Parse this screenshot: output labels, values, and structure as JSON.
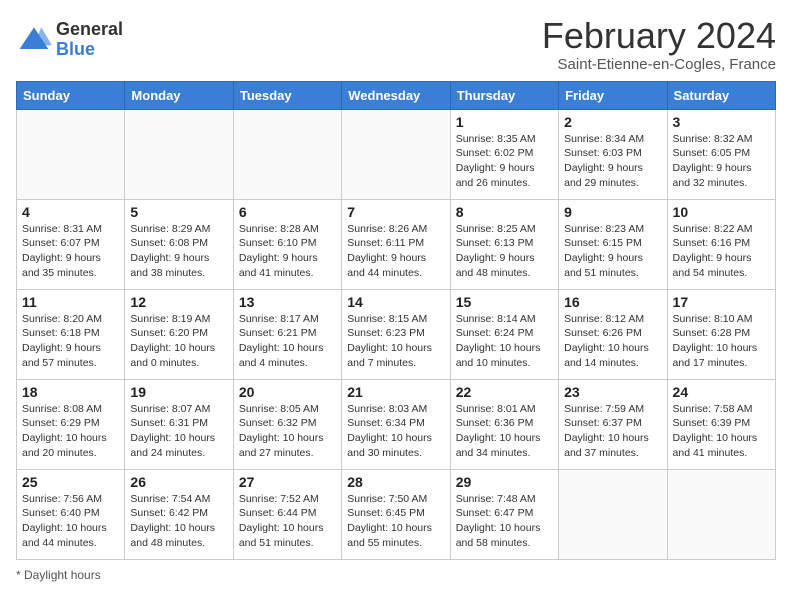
{
  "header": {
    "logo_general": "General",
    "logo_blue": "Blue",
    "title": "February 2024",
    "subtitle": "Saint-Etienne-en-Cogles, France"
  },
  "days_of_week": [
    "Sunday",
    "Monday",
    "Tuesday",
    "Wednesday",
    "Thursday",
    "Friday",
    "Saturday"
  ],
  "weeks": [
    [
      {
        "num": "",
        "info": ""
      },
      {
        "num": "",
        "info": ""
      },
      {
        "num": "",
        "info": ""
      },
      {
        "num": "",
        "info": ""
      },
      {
        "num": "1",
        "info": "Sunrise: 8:35 AM\nSunset: 6:02 PM\nDaylight: 9 hours and 26 minutes."
      },
      {
        "num": "2",
        "info": "Sunrise: 8:34 AM\nSunset: 6:03 PM\nDaylight: 9 hours and 29 minutes."
      },
      {
        "num": "3",
        "info": "Sunrise: 8:32 AM\nSunset: 6:05 PM\nDaylight: 9 hours and 32 minutes."
      }
    ],
    [
      {
        "num": "4",
        "info": "Sunrise: 8:31 AM\nSunset: 6:07 PM\nDaylight: 9 hours and 35 minutes."
      },
      {
        "num": "5",
        "info": "Sunrise: 8:29 AM\nSunset: 6:08 PM\nDaylight: 9 hours and 38 minutes."
      },
      {
        "num": "6",
        "info": "Sunrise: 8:28 AM\nSunset: 6:10 PM\nDaylight: 9 hours and 41 minutes."
      },
      {
        "num": "7",
        "info": "Sunrise: 8:26 AM\nSunset: 6:11 PM\nDaylight: 9 hours and 44 minutes."
      },
      {
        "num": "8",
        "info": "Sunrise: 8:25 AM\nSunset: 6:13 PM\nDaylight: 9 hours and 48 minutes."
      },
      {
        "num": "9",
        "info": "Sunrise: 8:23 AM\nSunset: 6:15 PM\nDaylight: 9 hours and 51 minutes."
      },
      {
        "num": "10",
        "info": "Sunrise: 8:22 AM\nSunset: 6:16 PM\nDaylight: 9 hours and 54 minutes."
      }
    ],
    [
      {
        "num": "11",
        "info": "Sunrise: 8:20 AM\nSunset: 6:18 PM\nDaylight: 9 hours and 57 minutes."
      },
      {
        "num": "12",
        "info": "Sunrise: 8:19 AM\nSunset: 6:20 PM\nDaylight: 10 hours and 0 minutes."
      },
      {
        "num": "13",
        "info": "Sunrise: 8:17 AM\nSunset: 6:21 PM\nDaylight: 10 hours and 4 minutes."
      },
      {
        "num": "14",
        "info": "Sunrise: 8:15 AM\nSunset: 6:23 PM\nDaylight: 10 hours and 7 minutes."
      },
      {
        "num": "15",
        "info": "Sunrise: 8:14 AM\nSunset: 6:24 PM\nDaylight: 10 hours and 10 minutes."
      },
      {
        "num": "16",
        "info": "Sunrise: 8:12 AM\nSunset: 6:26 PM\nDaylight: 10 hours and 14 minutes."
      },
      {
        "num": "17",
        "info": "Sunrise: 8:10 AM\nSunset: 6:28 PM\nDaylight: 10 hours and 17 minutes."
      }
    ],
    [
      {
        "num": "18",
        "info": "Sunrise: 8:08 AM\nSunset: 6:29 PM\nDaylight: 10 hours and 20 minutes."
      },
      {
        "num": "19",
        "info": "Sunrise: 8:07 AM\nSunset: 6:31 PM\nDaylight: 10 hours and 24 minutes."
      },
      {
        "num": "20",
        "info": "Sunrise: 8:05 AM\nSunset: 6:32 PM\nDaylight: 10 hours and 27 minutes."
      },
      {
        "num": "21",
        "info": "Sunrise: 8:03 AM\nSunset: 6:34 PM\nDaylight: 10 hours and 30 minutes."
      },
      {
        "num": "22",
        "info": "Sunrise: 8:01 AM\nSunset: 6:36 PM\nDaylight: 10 hours and 34 minutes."
      },
      {
        "num": "23",
        "info": "Sunrise: 7:59 AM\nSunset: 6:37 PM\nDaylight: 10 hours and 37 minutes."
      },
      {
        "num": "24",
        "info": "Sunrise: 7:58 AM\nSunset: 6:39 PM\nDaylight: 10 hours and 41 minutes."
      }
    ],
    [
      {
        "num": "25",
        "info": "Sunrise: 7:56 AM\nSunset: 6:40 PM\nDaylight: 10 hours and 44 minutes."
      },
      {
        "num": "26",
        "info": "Sunrise: 7:54 AM\nSunset: 6:42 PM\nDaylight: 10 hours and 48 minutes."
      },
      {
        "num": "27",
        "info": "Sunrise: 7:52 AM\nSunset: 6:44 PM\nDaylight: 10 hours and 51 minutes."
      },
      {
        "num": "28",
        "info": "Sunrise: 7:50 AM\nSunset: 6:45 PM\nDaylight: 10 hours and 55 minutes."
      },
      {
        "num": "29",
        "info": "Sunrise: 7:48 AM\nSunset: 6:47 PM\nDaylight: 10 hours and 58 minutes."
      },
      {
        "num": "",
        "info": ""
      },
      {
        "num": "",
        "info": ""
      }
    ]
  ],
  "footer": {
    "note": "Daylight hours"
  }
}
